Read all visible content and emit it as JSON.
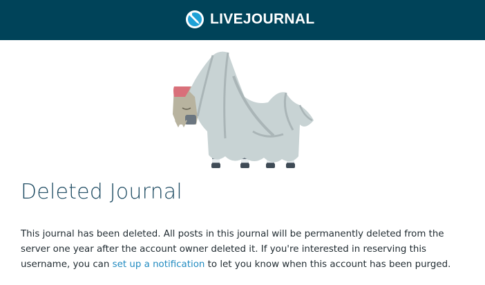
{
  "header": {
    "brand_text": "LIVEJOURNAL",
    "logo_icon": "livejournal-pencil-logo-icon",
    "background_color": "#004359"
  },
  "illustration": {
    "icon": "ghost-horse-icon"
  },
  "main": {
    "title": "Deleted Journal",
    "message_before_link": "This journal has been deleted. All posts in this journal will be permanently deleted from the server one year after the account owner deleted it. If you're interested in reserving this username, you can ",
    "link_text": "set up a notification",
    "message_after_link": " to let you know when this account has been purged.",
    "link_color": "#1f8ac0",
    "title_color": "#1f4c63"
  }
}
